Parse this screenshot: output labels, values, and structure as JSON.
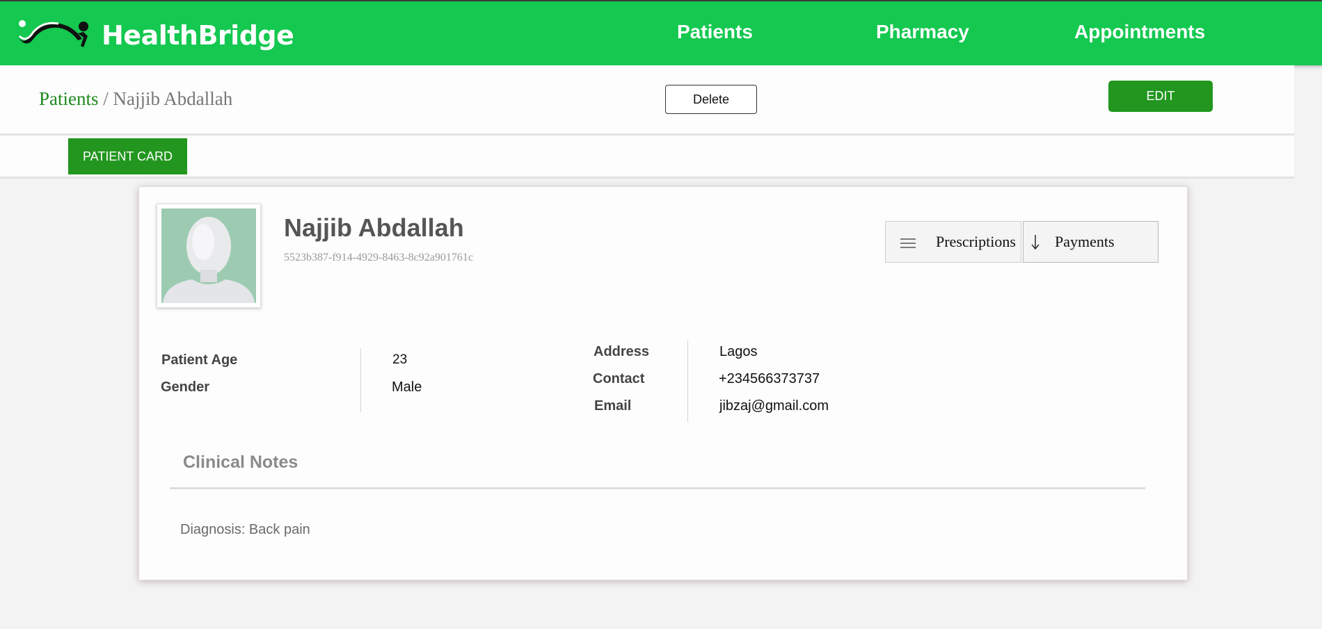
{
  "app": {
    "brand": "HealthBridge",
    "accent_color": "#14c850",
    "button_color": "#22961f"
  },
  "nav": {
    "items": [
      {
        "label": "Patients"
      },
      {
        "label": "Pharmacy"
      },
      {
        "label": "Appointments"
      }
    ]
  },
  "breadcrumb": {
    "parent": "Patients",
    "separator": "/",
    "current": "Najjib Abdallah"
  },
  "actions": {
    "delete_label": "Delete",
    "edit_label": "EDIT"
  },
  "tabs": {
    "active_label": "PATIENT CARD"
  },
  "patient": {
    "name": "Najjib Abdallah",
    "id": "5523b387-f914-4929-8463-8c92a901761c",
    "avatar_icon": "user-silhouette-icon",
    "quick_actions": [
      {
        "label": "Prescriptions",
        "icon": "menu-icon"
      },
      {
        "label": "Payments",
        "icon": "arrow-down-icon"
      }
    ],
    "details_left": [
      {
        "label": "Patient Age",
        "value": "23"
      },
      {
        "label": "Gender",
        "value": "Male"
      }
    ],
    "details_right": [
      {
        "label": "Address",
        "value": "Lagos"
      },
      {
        "label": "Contact",
        "value": "+234566373737"
      },
      {
        "label": "Email",
        "value": "jibzaj@gmail.com"
      }
    ]
  },
  "clinical_notes": {
    "title": "Clinical Notes",
    "text": "Diagnosis: Back pain"
  }
}
